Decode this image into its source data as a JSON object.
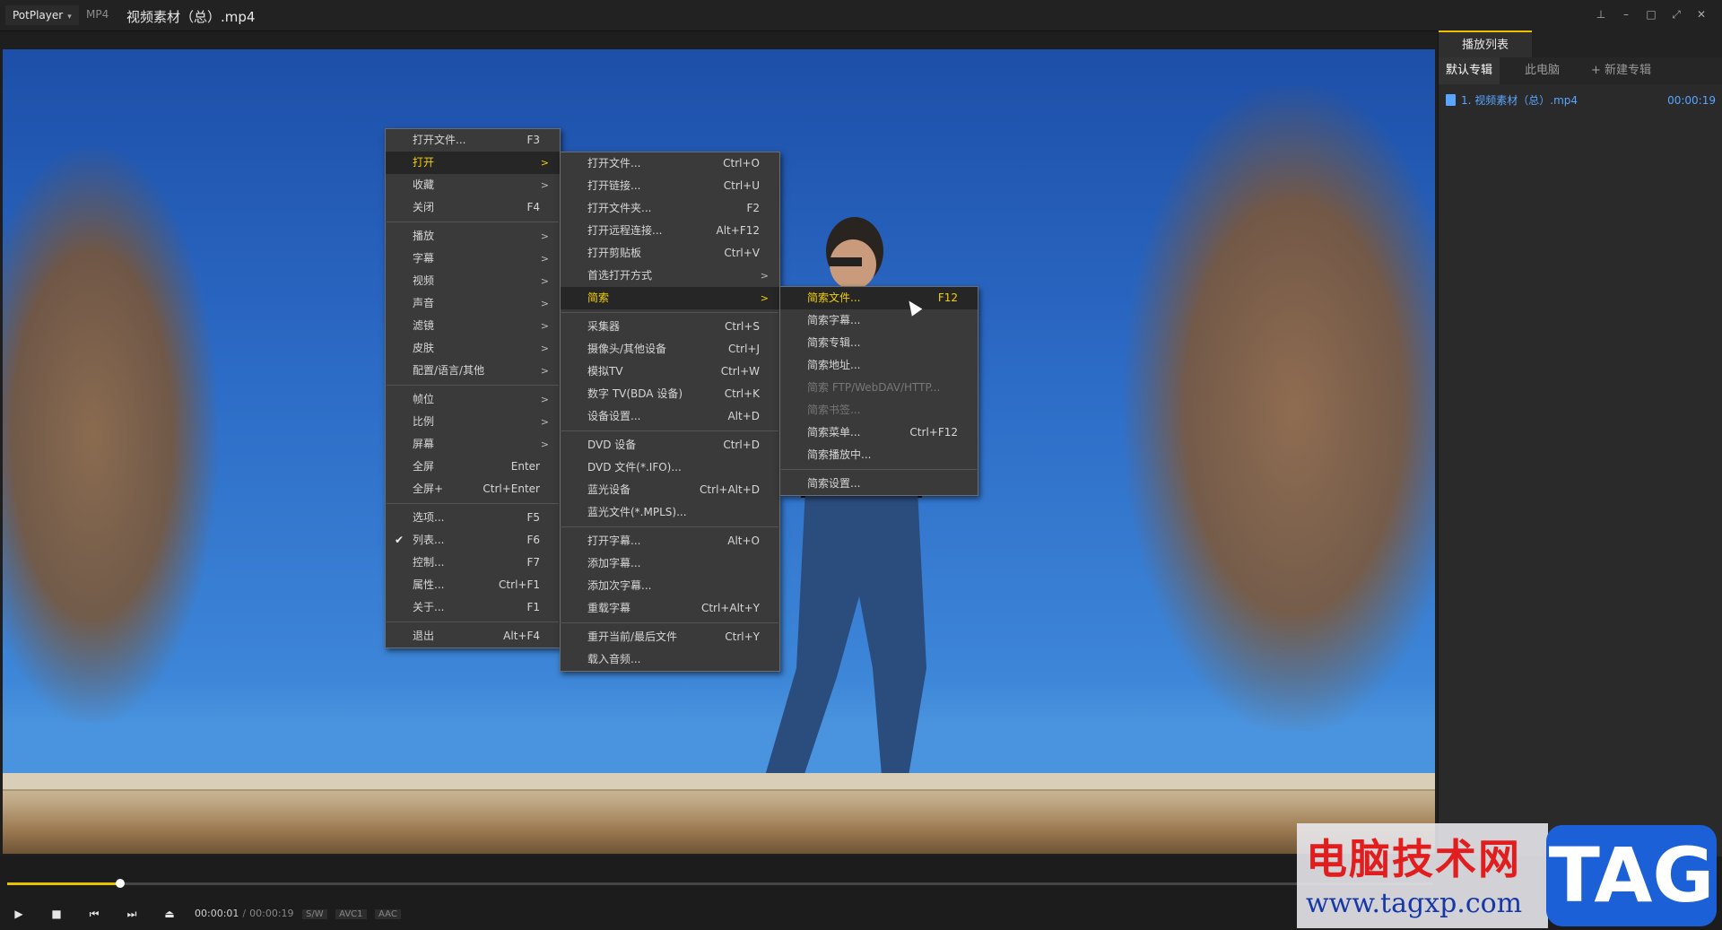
{
  "titlebar": {
    "app_name": "PotPlayer",
    "format": "MP4",
    "title": "视频素材（总）.mp4"
  },
  "playlist": {
    "tab_main": "播放列表",
    "subtabs": [
      "默认专辑",
      "此电脑",
      "+ 新建专辑"
    ],
    "items": [
      {
        "name": "1. 视频素材（总）.mp4",
        "duration": "00:00:19"
      }
    ]
  },
  "controls": {
    "current_time": "00:00:01",
    "total_time": "00:00:19",
    "tags": [
      "S/W",
      "AVC1",
      "AAC"
    ],
    "progress": 0.079
  },
  "main_menu": [
    {
      "label": "打开文件...",
      "shortcut": "F3"
    },
    {
      "label": "打开",
      "arrow": ">",
      "highlight": true
    },
    {
      "label": "收藏",
      "arrow": ">"
    },
    {
      "label": "关闭",
      "shortcut": "F4"
    },
    {
      "sep": true
    },
    {
      "label": "播放",
      "arrow": ">"
    },
    {
      "label": "字幕",
      "arrow": ">"
    },
    {
      "label": "视频",
      "arrow": ">"
    },
    {
      "label": "声音",
      "arrow": ">"
    },
    {
      "label": "滤镜",
      "arrow": ">"
    },
    {
      "label": "皮肤",
      "arrow": ">"
    },
    {
      "label": "配置/语言/其他",
      "arrow": ">"
    },
    {
      "sep": true
    },
    {
      "label": "帧位",
      "arrow": ">"
    },
    {
      "label": "比例",
      "arrow": ">"
    },
    {
      "label": "屏幕",
      "arrow": ">"
    },
    {
      "label": "全屏",
      "shortcut": "Enter"
    },
    {
      "label": "全屏+",
      "shortcut": "Ctrl+Enter"
    },
    {
      "sep": true
    },
    {
      "label": "选项...",
      "shortcut": "F5"
    },
    {
      "label": "列表...",
      "shortcut": "F6",
      "checked": true
    },
    {
      "label": "控制...",
      "shortcut": "F7"
    },
    {
      "label": "属性...",
      "shortcut": "Ctrl+F1"
    },
    {
      "label": "关于...",
      "shortcut": "F1"
    },
    {
      "sep": true
    },
    {
      "label": "退出",
      "shortcut": "Alt+F4"
    }
  ],
  "open_menu": [
    {
      "label": "打开文件...",
      "shortcut": "Ctrl+O"
    },
    {
      "label": "打开链接...",
      "shortcut": "Ctrl+U"
    },
    {
      "label": "打开文件夹...",
      "shortcut": "F2"
    },
    {
      "label": "打开远程连接...",
      "shortcut": "Alt+F12"
    },
    {
      "label": "打开剪贴板",
      "shortcut": "Ctrl+V"
    },
    {
      "label": "首选打开方式",
      "arrow": ">"
    },
    {
      "label": "简索",
      "arrow": ">",
      "highlight": true
    },
    {
      "sep": true
    },
    {
      "label": "采集器",
      "shortcut": "Ctrl+S"
    },
    {
      "label": "摄像头/其他设备",
      "shortcut": "Ctrl+J"
    },
    {
      "label": "模拟TV",
      "shortcut": "Ctrl+W"
    },
    {
      "label": "数字 TV(BDA 设备)",
      "shortcut": "Ctrl+K"
    },
    {
      "label": "设备设置...",
      "shortcut": "Alt+D"
    },
    {
      "sep": true
    },
    {
      "label": "DVD 设备",
      "shortcut": "Ctrl+D"
    },
    {
      "label": "DVD 文件(*.IFO)..."
    },
    {
      "label": "蓝光设备",
      "shortcut": "Ctrl+Alt+D"
    },
    {
      "label": "蓝光文件(*.MPLS)..."
    },
    {
      "sep": true
    },
    {
      "label": "打开字幕...",
      "shortcut": "Alt+O"
    },
    {
      "label": "添加字幕..."
    },
    {
      "label": "添加次字幕..."
    },
    {
      "label": "重载字幕",
      "shortcut": "Ctrl+Alt+Y"
    },
    {
      "sep": true
    },
    {
      "label": "重开当前/最后文件",
      "shortcut": "Ctrl+Y"
    },
    {
      "label": "载入音频..."
    }
  ],
  "search_menu": [
    {
      "label": "简索文件...",
      "shortcut": "F12",
      "highlight": true
    },
    {
      "label": "简索字幕..."
    },
    {
      "label": "简索专辑..."
    },
    {
      "label": "简索地址..."
    },
    {
      "label": "简索 FTP/WebDAV/HTTP...",
      "disabled": true
    },
    {
      "label": "简索书签...",
      "disabled": true
    },
    {
      "label": "简索菜单...",
      "shortcut": "Ctrl+F12"
    },
    {
      "label": "简索播放中..."
    },
    {
      "sep": true
    },
    {
      "label": "简索设置..."
    }
  ],
  "watermark": {
    "cn": "电脑技术网",
    "url": "www.tagxp.com",
    "tag": "TAG"
  },
  "colors": {
    "accent": "#f4d000",
    "playlist_link": "#5aa5ff",
    "menu_bg": "#3a3a3a"
  }
}
